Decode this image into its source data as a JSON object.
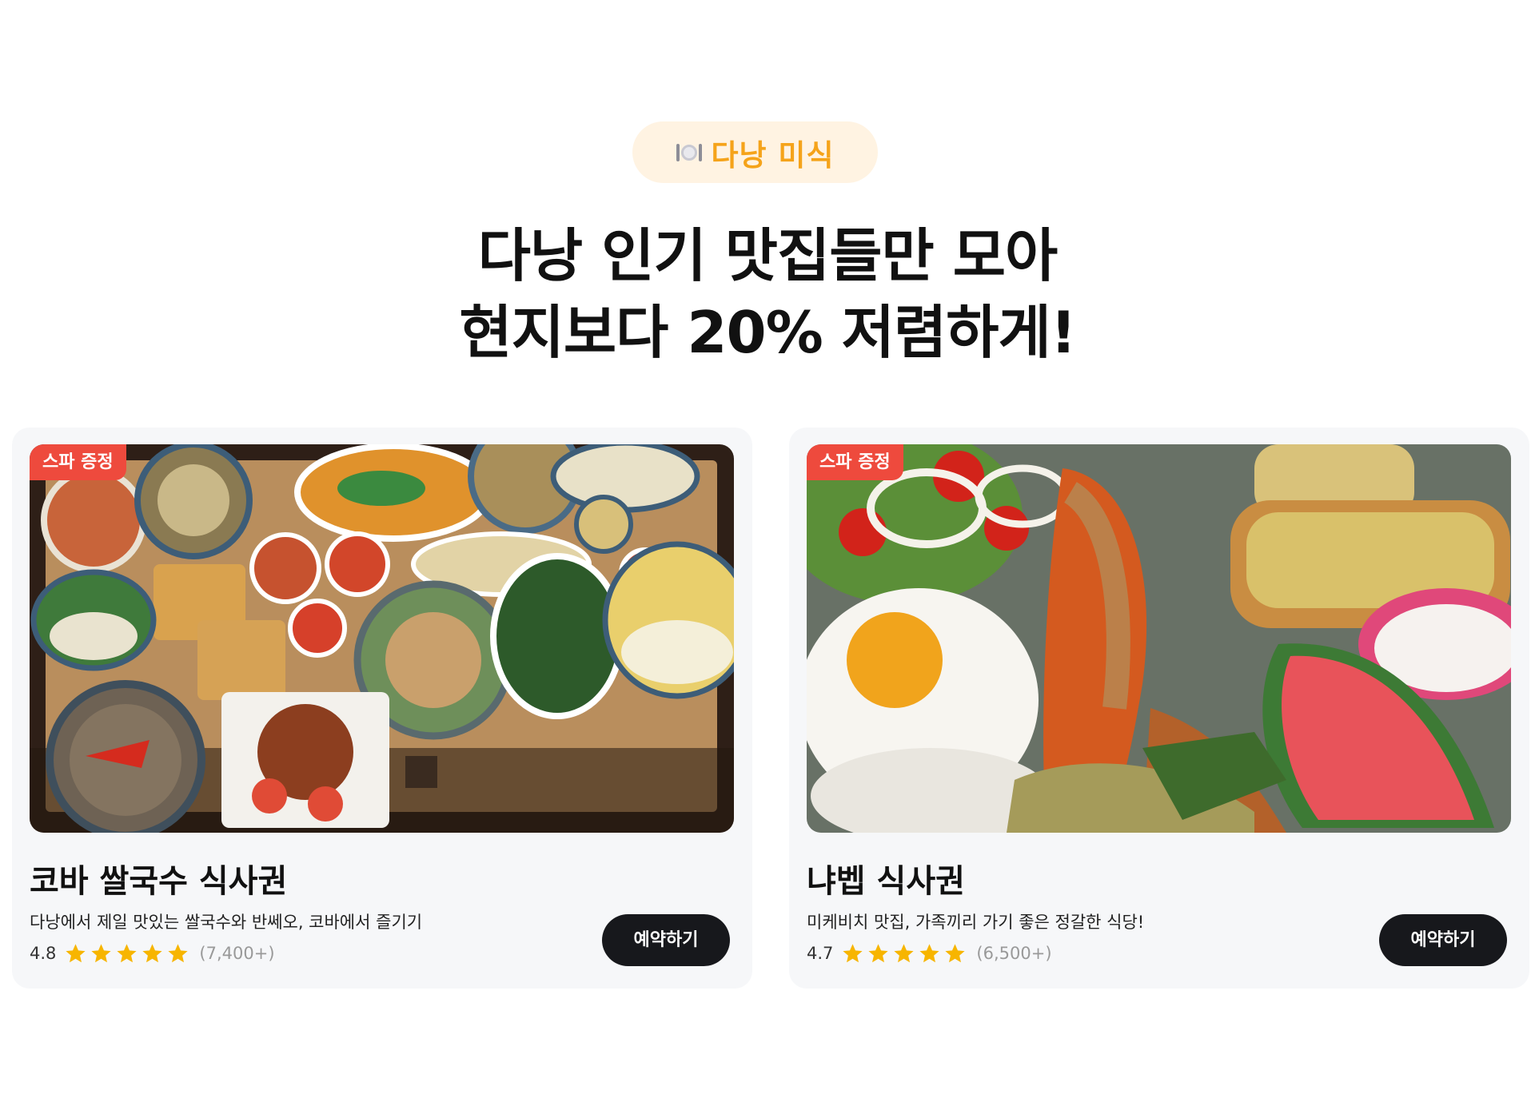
{
  "section": {
    "pill": {
      "icon": "plate-cutlery-icon",
      "label": "다낭 미식"
    },
    "headline": {
      "line1": "다낭 인기 맛집들만 모아",
      "line2": "현지보다 20% 저렴하게!"
    }
  },
  "colors": {
    "accent_orange": "#f5a31a",
    "pill_bg": "#fff3e2",
    "badge_red": "#ee4a3d",
    "button_dark": "#17181c",
    "star_yellow": "#f7b500",
    "card_bg": "#f6f7f9"
  },
  "cards": [
    {
      "badge": "스파 증정",
      "image_icon": "vietnamese-dishes-photo",
      "title": "코바 쌀국수 식사권",
      "description": "다낭에서 제일 맛있는 쌀국수와 반쎄오, 코바에서 즐기기",
      "rating": "4.8",
      "stars": 5,
      "review_count": "(7,400+)",
      "button": "예약하기"
    },
    {
      "badge": "스파 증정",
      "image_icon": "seafood-platter-photo",
      "title": "냐벱 식사권",
      "description": "미케비치 맛집, 가족끼리 가기 좋은 정갈한 식당!",
      "rating": "4.7",
      "stars": 5,
      "review_count": "(6,500+)",
      "button": "예약하기"
    }
  ]
}
